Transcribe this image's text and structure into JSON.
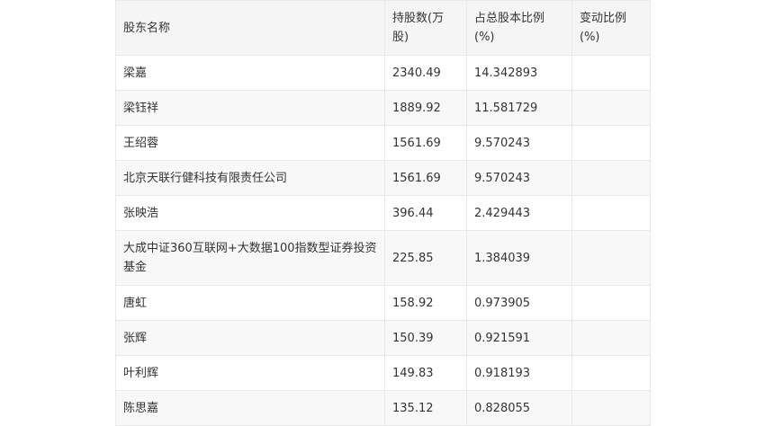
{
  "table": {
    "headers": {
      "name": "股东名称",
      "shares": "持股数(万股)",
      "pct": "占总股本比例(%)",
      "change": "变动比例(%)"
    },
    "rows": [
      {
        "name": "梁嘉",
        "shares": "2340.49",
        "pct": "14.342893",
        "change": ""
      },
      {
        "name": "梁钰祥",
        "shares": "1889.92",
        "pct": "11.581729",
        "change": ""
      },
      {
        "name": "王绍蓉",
        "shares": "1561.69",
        "pct": "9.570243",
        "change": ""
      },
      {
        "name": "北京天联行健科技有限责任公司",
        "shares": "1561.69",
        "pct": "9.570243",
        "change": ""
      },
      {
        "name": "张映浩",
        "shares": "396.44",
        "pct": "2.429443",
        "change": ""
      },
      {
        "name": "大成中证360互联网+大数据100指数型证券投资基金",
        "shares": "225.85",
        "pct": "1.384039",
        "change": ""
      },
      {
        "name": "唐虹",
        "shares": "158.92",
        "pct": "0.973905",
        "change": ""
      },
      {
        "name": "张辉",
        "shares": "150.39",
        "pct": "0.921591",
        "change": ""
      },
      {
        "name": "叶利辉",
        "shares": "149.83",
        "pct": "0.918193",
        "change": ""
      },
      {
        "name": "陈思嘉",
        "shares": "135.12",
        "pct": "0.828055",
        "change": ""
      }
    ]
  }
}
